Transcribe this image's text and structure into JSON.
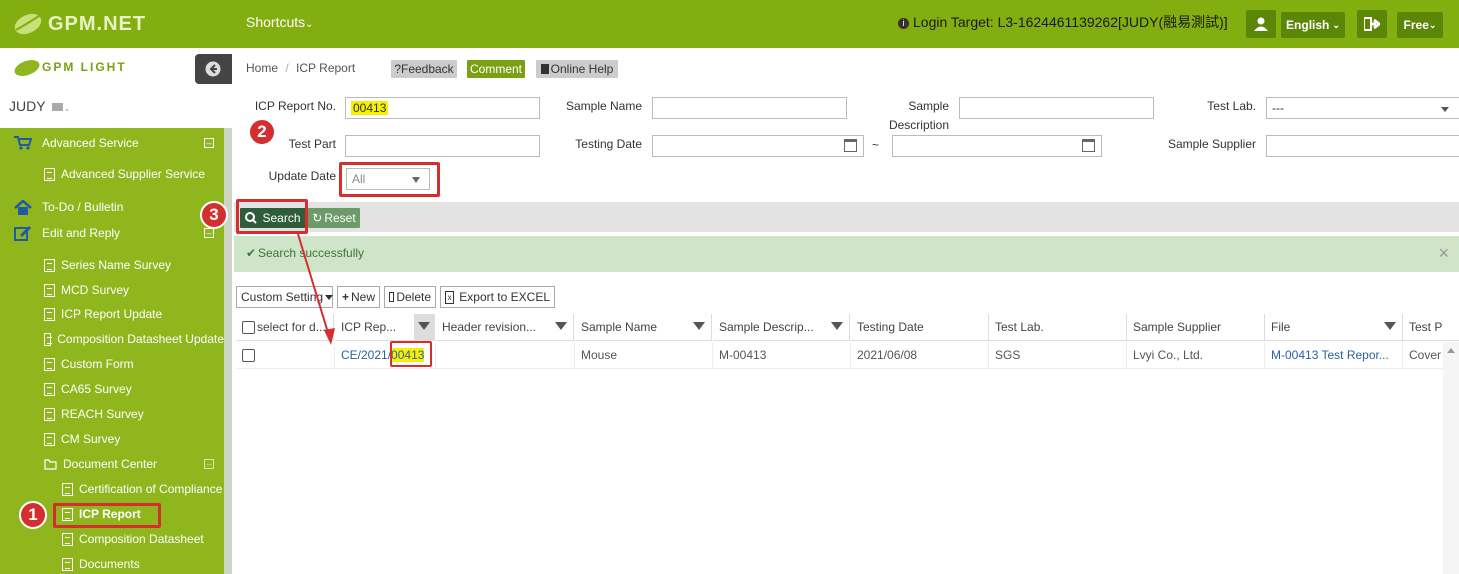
{
  "topbar": {
    "logo": "GPM.NET",
    "shortcuts": "Shortcuts",
    "login_target": "Login Target:  L3-1624461139262[JUDY(融易測試)]",
    "language": "English",
    "plan": "Free"
  },
  "sidebar": {
    "logo_text": "GPM LIGHT",
    "user": "JUDY",
    "items": [
      {
        "label": "Advanced Service"
      },
      {
        "label": "Advanced Supplier Service"
      },
      {
        "label": "To-Do / Bulletin"
      },
      {
        "label": "Edit and Reply"
      },
      {
        "label": "Series Name Survey"
      },
      {
        "label": "MCD Survey"
      },
      {
        "label": "ICP Report Update"
      },
      {
        "label": "Composition Datasheet Update"
      },
      {
        "label": "Custom Form"
      },
      {
        "label": "CA65 Survey"
      },
      {
        "label": "REACH Survey"
      },
      {
        "label": "CM Survey"
      },
      {
        "label": "Document Center"
      },
      {
        "label": "Certification of Compliance"
      },
      {
        "label": "ICP Report"
      },
      {
        "label": "Composition Datasheet"
      },
      {
        "label": "Documents"
      }
    ]
  },
  "breadcrumb": {
    "home": "Home",
    "sep": "/",
    "current": "ICP Report"
  },
  "header_buttons": {
    "feedback": "?Feedback",
    "comment": "Comment",
    "help": "Online Help"
  },
  "form": {
    "icp_report_no_label": "ICP Report No.",
    "icp_report_no_value": "00413",
    "sample_name_label": "Sample Name",
    "sample_desc_label_1": "Sample",
    "sample_desc_label_2": "Description",
    "test_lab_label": "Test Lab.",
    "test_lab_value": "---",
    "test_part_label": "Test Part",
    "testing_date_label": "Testing Date",
    "date_sep": "~",
    "sample_supplier_label": "Sample Supplier",
    "update_date_label": "Update Date",
    "update_date_value": "All"
  },
  "actions": {
    "search": "Search",
    "reset": "Reset"
  },
  "alert": {
    "message": "Search successfully",
    "close": "×"
  },
  "toolbar": {
    "custom": "Custom Setting",
    "new": "New",
    "delete": "Delete",
    "export": "Export to EXCEL"
  },
  "table": {
    "headers": [
      "select for d...",
      "ICP Rep...",
      "Header revision...",
      "Sample Name",
      "Sample Descrip...",
      "Testing Date",
      "Test Lab.",
      "Sample Supplier",
      "File",
      "Test P"
    ],
    "row": {
      "icp_prefix": "CE/2021/",
      "icp_highlight": "00413",
      "header_revision": "",
      "sample_name": "Mouse",
      "sample_desc": "M-00413",
      "testing_date": "2021/06/08",
      "test_lab": "SGS",
      "sample_supplier": "Lvyi Co., Ltd.",
      "file": "M-00413 Test Repor...",
      "test_part": "Cover"
    }
  },
  "callouts": [
    "1",
    "2",
    "3"
  ],
  "colors": {
    "green_top": "#82ae0f",
    "green_side": "#8fb61d",
    "red": "#d32f2f",
    "highlight": "#f7f000"
  }
}
